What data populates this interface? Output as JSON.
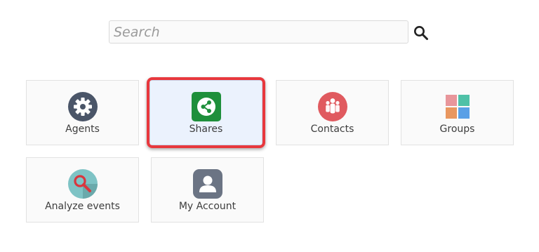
{
  "search": {
    "placeholder": "Search",
    "value": ""
  },
  "tiles": [
    {
      "label": "Agents",
      "icon": "gear-icon",
      "color": "#4a5568"
    },
    {
      "label": "Shares",
      "icon": "share-icon",
      "color": "#1e8f3b",
      "selected": true
    },
    {
      "label": "Contacts",
      "icon": "contacts-icon",
      "color": "#e05a5f"
    },
    {
      "label": "Groups",
      "icon": "groups-icon"
    },
    {
      "label": "Analyze events",
      "icon": "analyze-events-icon",
      "color": "#7ec3c5"
    },
    {
      "label": "My Account",
      "icon": "my-account-icon",
      "color": "#6b7484"
    }
  ],
  "colors": {
    "highlight": "#e8383d",
    "selected_bg": "#ebf2fd"
  }
}
